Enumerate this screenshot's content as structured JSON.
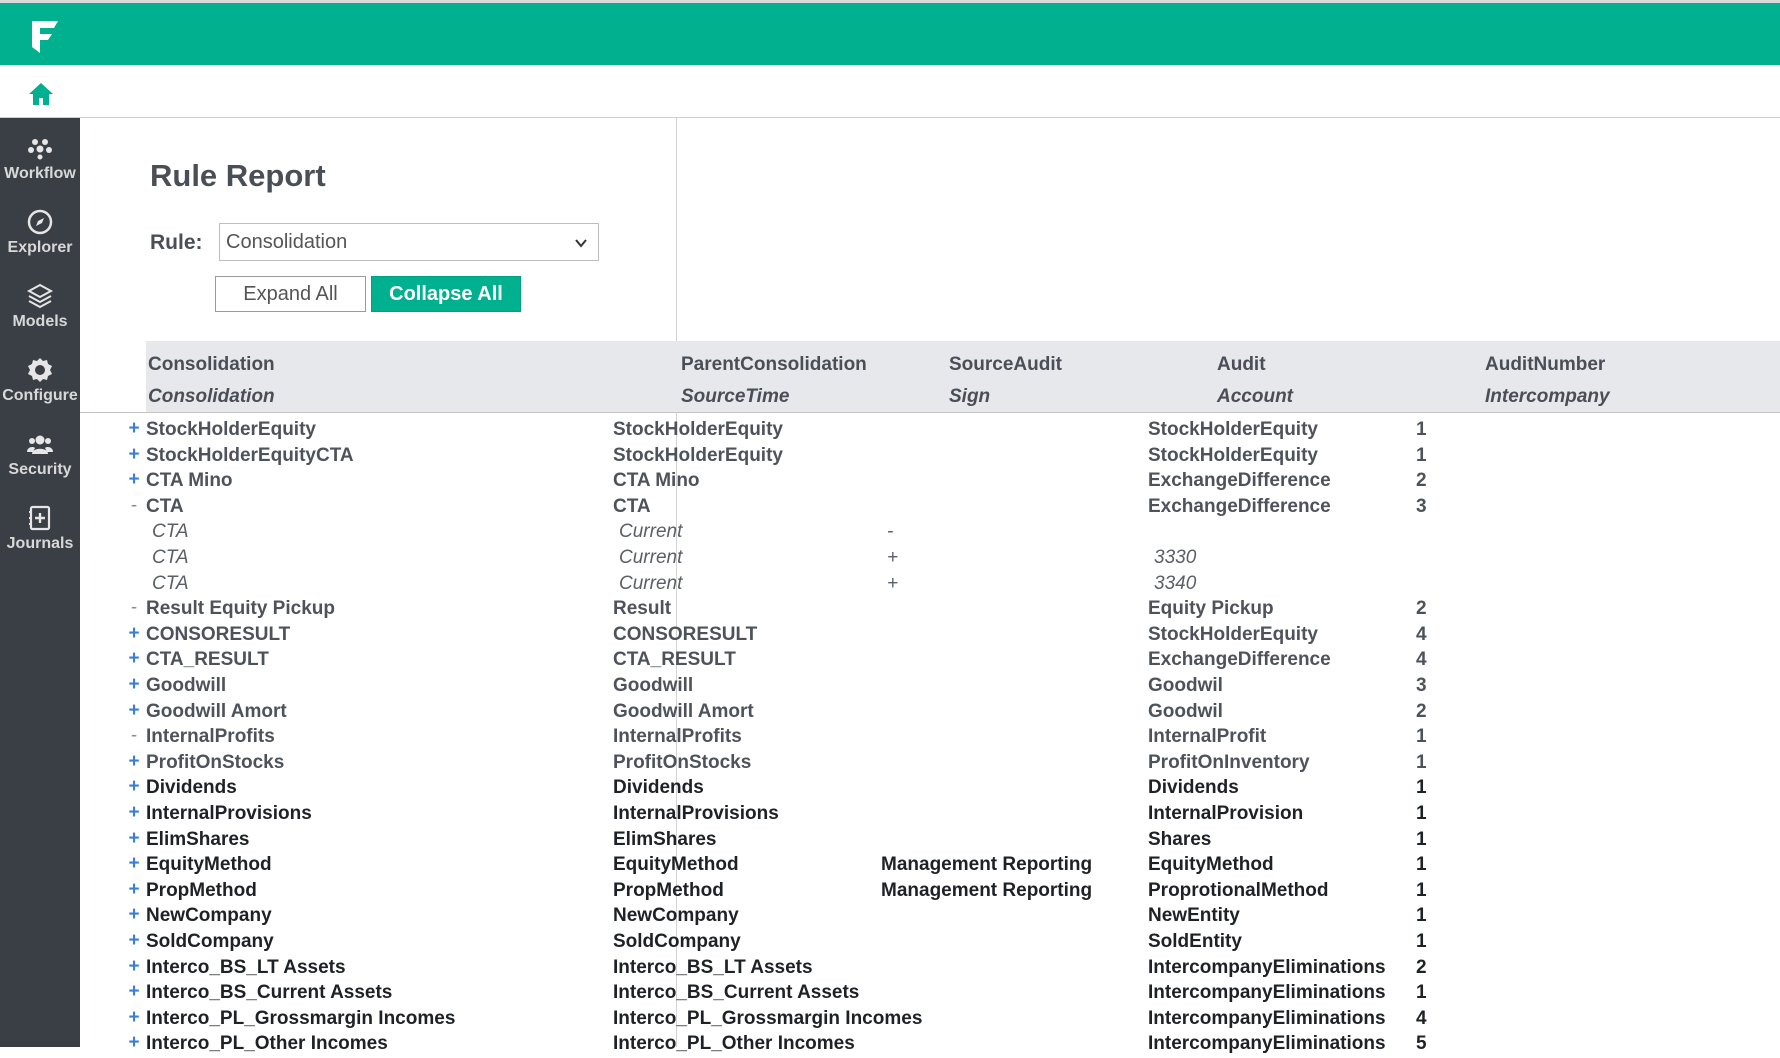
{
  "nav": {
    "home_icon": "home-icon",
    "items": [
      {
        "label": "Workflow",
        "icon": "workflow-icon"
      },
      {
        "label": "Explorer",
        "icon": "compass-icon"
      },
      {
        "label": "Models",
        "icon": "layers-icon"
      },
      {
        "label": "Configure",
        "icon": "gear-icon"
      },
      {
        "label": "Security",
        "icon": "users-icon"
      },
      {
        "label": "Journals",
        "icon": "journal-icon"
      }
    ]
  },
  "colors": {
    "brand": "#00b08e",
    "sidebar": "#3a3e45",
    "expand_toggle": "#3a7fd6"
  },
  "report": {
    "title": "Rule Report",
    "rule_label": "Rule:",
    "rule_value": "Consolidation",
    "expand_all": "Expand All",
    "collapse_all": "Collapse All"
  },
  "table": {
    "headers": [
      "Consolidation",
      "ParentConsolidation",
      "SourceAudit",
      "Audit",
      "AuditNumber"
    ],
    "subheaders": [
      "Consolidation",
      "SourceTime",
      "Sign",
      "Account",
      "Intercompany"
    ],
    "rows": [
      {
        "toggle": "+",
        "c": [
          "StockHolderEquity",
          "StockHolderEquity",
          "",
          "StockHolderEquity",
          "1"
        ]
      },
      {
        "toggle": "+",
        "c": [
          "StockHolderEquityCTA",
          "StockHolderEquity",
          "",
          "StockHolderEquity",
          "1"
        ]
      },
      {
        "toggle": "+",
        "c": [
          "CTA Mino",
          "CTA Mino",
          "",
          "ExchangeDifference",
          "2"
        ]
      },
      {
        "toggle": "-",
        "c": [
          "CTA",
          "CTA",
          "",
          "ExchangeDifference",
          "3"
        ]
      },
      {
        "toggle": "",
        "child": true,
        "c": [
          "CTA",
          "Current",
          "-",
          "",
          ""
        ]
      },
      {
        "toggle": "",
        "child": true,
        "c": [
          "CTA",
          "Current",
          "+",
          "3330",
          ""
        ]
      },
      {
        "toggle": "",
        "child": true,
        "c": [
          "CTA",
          "Current",
          "+",
          "3340",
          ""
        ]
      },
      {
        "toggle": "-",
        "c": [
          "Result Equity Pickup",
          "Result",
          "",
          "Equity Pickup",
          "2"
        ]
      },
      {
        "toggle": "+",
        "c": [
          "CONSORESULT",
          "CONSORESULT",
          "",
          "StockHolderEquity",
          "4"
        ]
      },
      {
        "toggle": "+",
        "c": [
          "CTA_RESULT",
          "CTA_RESULT",
          "",
          "ExchangeDifference",
          "4"
        ]
      },
      {
        "toggle": "+",
        "c": [
          "Goodwill",
          "Goodwill",
          "",
          "Goodwil",
          "3"
        ]
      },
      {
        "toggle": "+",
        "c": [
          "Goodwill Amort",
          "Goodwill Amort",
          "",
          "Goodwil",
          "2"
        ]
      },
      {
        "toggle": "-",
        "c": [
          "InternalProfits",
          "InternalProfits",
          "",
          "InternalProfit",
          "1"
        ]
      },
      {
        "toggle": "+",
        "c": [
          "ProfitOnStocks",
          "ProfitOnStocks",
          "",
          "ProfitOnInventory",
          "1"
        ]
      },
      {
        "toggle": "+",
        "dark": true,
        "c": [
          "Dividends",
          "Dividends",
          "",
          "Dividends",
          "1"
        ]
      },
      {
        "toggle": "+",
        "dark": true,
        "c": [
          "InternalProvisions",
          "InternalProvisions",
          "",
          "InternalProvision",
          "1"
        ]
      },
      {
        "toggle": "+",
        "dark": true,
        "c": [
          "ElimShares",
          "ElimShares",
          "",
          "Shares",
          "1"
        ]
      },
      {
        "toggle": "+",
        "dark": true,
        "c": [
          "EquityMethod",
          "EquityMethod",
          "Management Reporting",
          "EquityMethod",
          "1"
        ]
      },
      {
        "toggle": "+",
        "dark": true,
        "c": [
          "PropMethod",
          "PropMethod",
          "Management Reporting",
          "ProprotionalMethod",
          "1"
        ]
      },
      {
        "toggle": "+",
        "dark": true,
        "c": [
          "NewCompany",
          "NewCompany",
          "",
          "NewEntity",
          "1"
        ]
      },
      {
        "toggle": "+",
        "dark": true,
        "c": [
          "SoldCompany",
          "SoldCompany",
          "",
          "SoldEntity",
          "1"
        ]
      },
      {
        "toggle": "+",
        "dark": true,
        "c": [
          "Interco_BS_LT Assets",
          "Interco_BS_LT Assets",
          "",
          "IntercompanyEliminations",
          "2"
        ]
      },
      {
        "toggle": "+",
        "dark": true,
        "c": [
          "Interco_BS_Current Assets",
          "Interco_BS_Current Assets",
          "",
          "IntercompanyEliminations",
          "1"
        ]
      },
      {
        "toggle": "+",
        "dark": true,
        "c": [
          "Interco_PL_Grossmargin Incomes",
          "Interco_PL_Grossmargin Incomes",
          "",
          "IntercompanyEliminations",
          "4"
        ]
      },
      {
        "toggle": "+",
        "dark": true,
        "c": [
          "Interco_PL_Other Incomes",
          "Interco_PL_Other Incomes",
          "",
          "IntercompanyEliminations",
          "5"
        ]
      }
    ]
  }
}
